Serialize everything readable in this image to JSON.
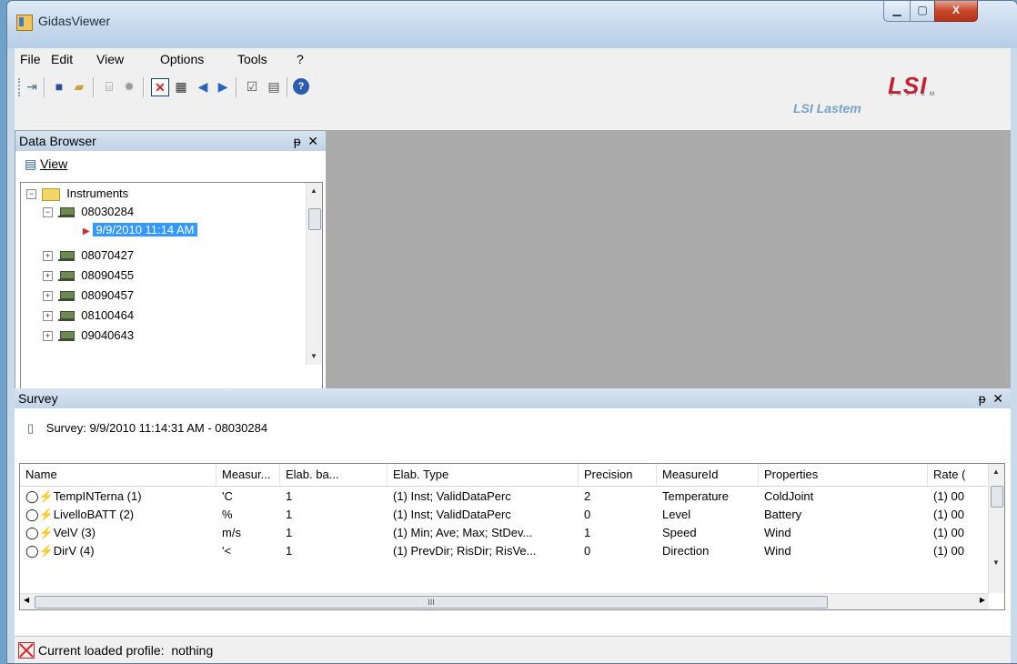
{
  "window": {
    "title": "GidasViewer",
    "minimize_glyph": "▁",
    "maximize_glyph": "▢",
    "close_glyph": "X"
  },
  "menu": [
    "File",
    "Edit",
    "View",
    "Options",
    "Tools",
    "?"
  ],
  "brand": {
    "text": "LSI Lastem",
    "logo_text": "LSI",
    "logo_subtext": "LASTEM"
  },
  "toolbar_icons": [
    "open-icon",
    "save-icon",
    "open-folder-icon",
    "device-icon",
    "settings-icon",
    "clear-profile-icon",
    "grid-icon",
    "previous-icon",
    "next-icon",
    "chart-icon",
    "report-icon",
    "help-icon"
  ],
  "data_browser": {
    "title": "Data Browser",
    "pin_glyph": "ᵽ",
    "close_glyph": "✕",
    "view_label": "View",
    "tree": {
      "root": "Instruments",
      "items": [
        {
          "label": "08030284",
          "expanded": true,
          "child": "9/9/2010 11:14 AM"
        },
        {
          "label": "08070427"
        },
        {
          "label": "08090455"
        },
        {
          "label": "08090457"
        },
        {
          "label": "08100464"
        },
        {
          "label": "09040643"
        }
      ]
    }
  },
  "survey": {
    "title": "Survey",
    "caption": "Survey: 9/9/2010 11:14:31 AM - 08030284",
    "columns": [
      "Name",
      "Measur...",
      "Elab. ba...",
      "Elab. Type",
      "Precision",
      "MeasureId",
      "Properties",
      "Rate ("
    ],
    "rows": [
      [
        "TempINTerna (1)",
        "'C",
        "1",
        "(1) Inst; ValidDataPerc",
        "2",
        "Temperature",
        "ColdJoint",
        "(1) 00"
      ],
      [
        "LivelloBATT (2)",
        "%",
        "1",
        "(1) Inst; ValidDataPerc",
        "0",
        "Level",
        "Battery",
        "(1) 00"
      ],
      [
        "VelV (3)",
        "m/s",
        "1",
        "(1) Min; Ave; Max; StDev...",
        "1",
        "Speed",
        "Wind",
        "(1) 00"
      ],
      [
        "DirV (4)",
        "'<",
        "1",
        "(1) PrevDir; RisDir; RisVe...",
        "0",
        "Direction",
        "Wind",
        "(1) 00"
      ]
    ],
    "hscroll_grip": "III"
  },
  "status": {
    "label": "Current loaded profile:",
    "value": "nothing"
  }
}
